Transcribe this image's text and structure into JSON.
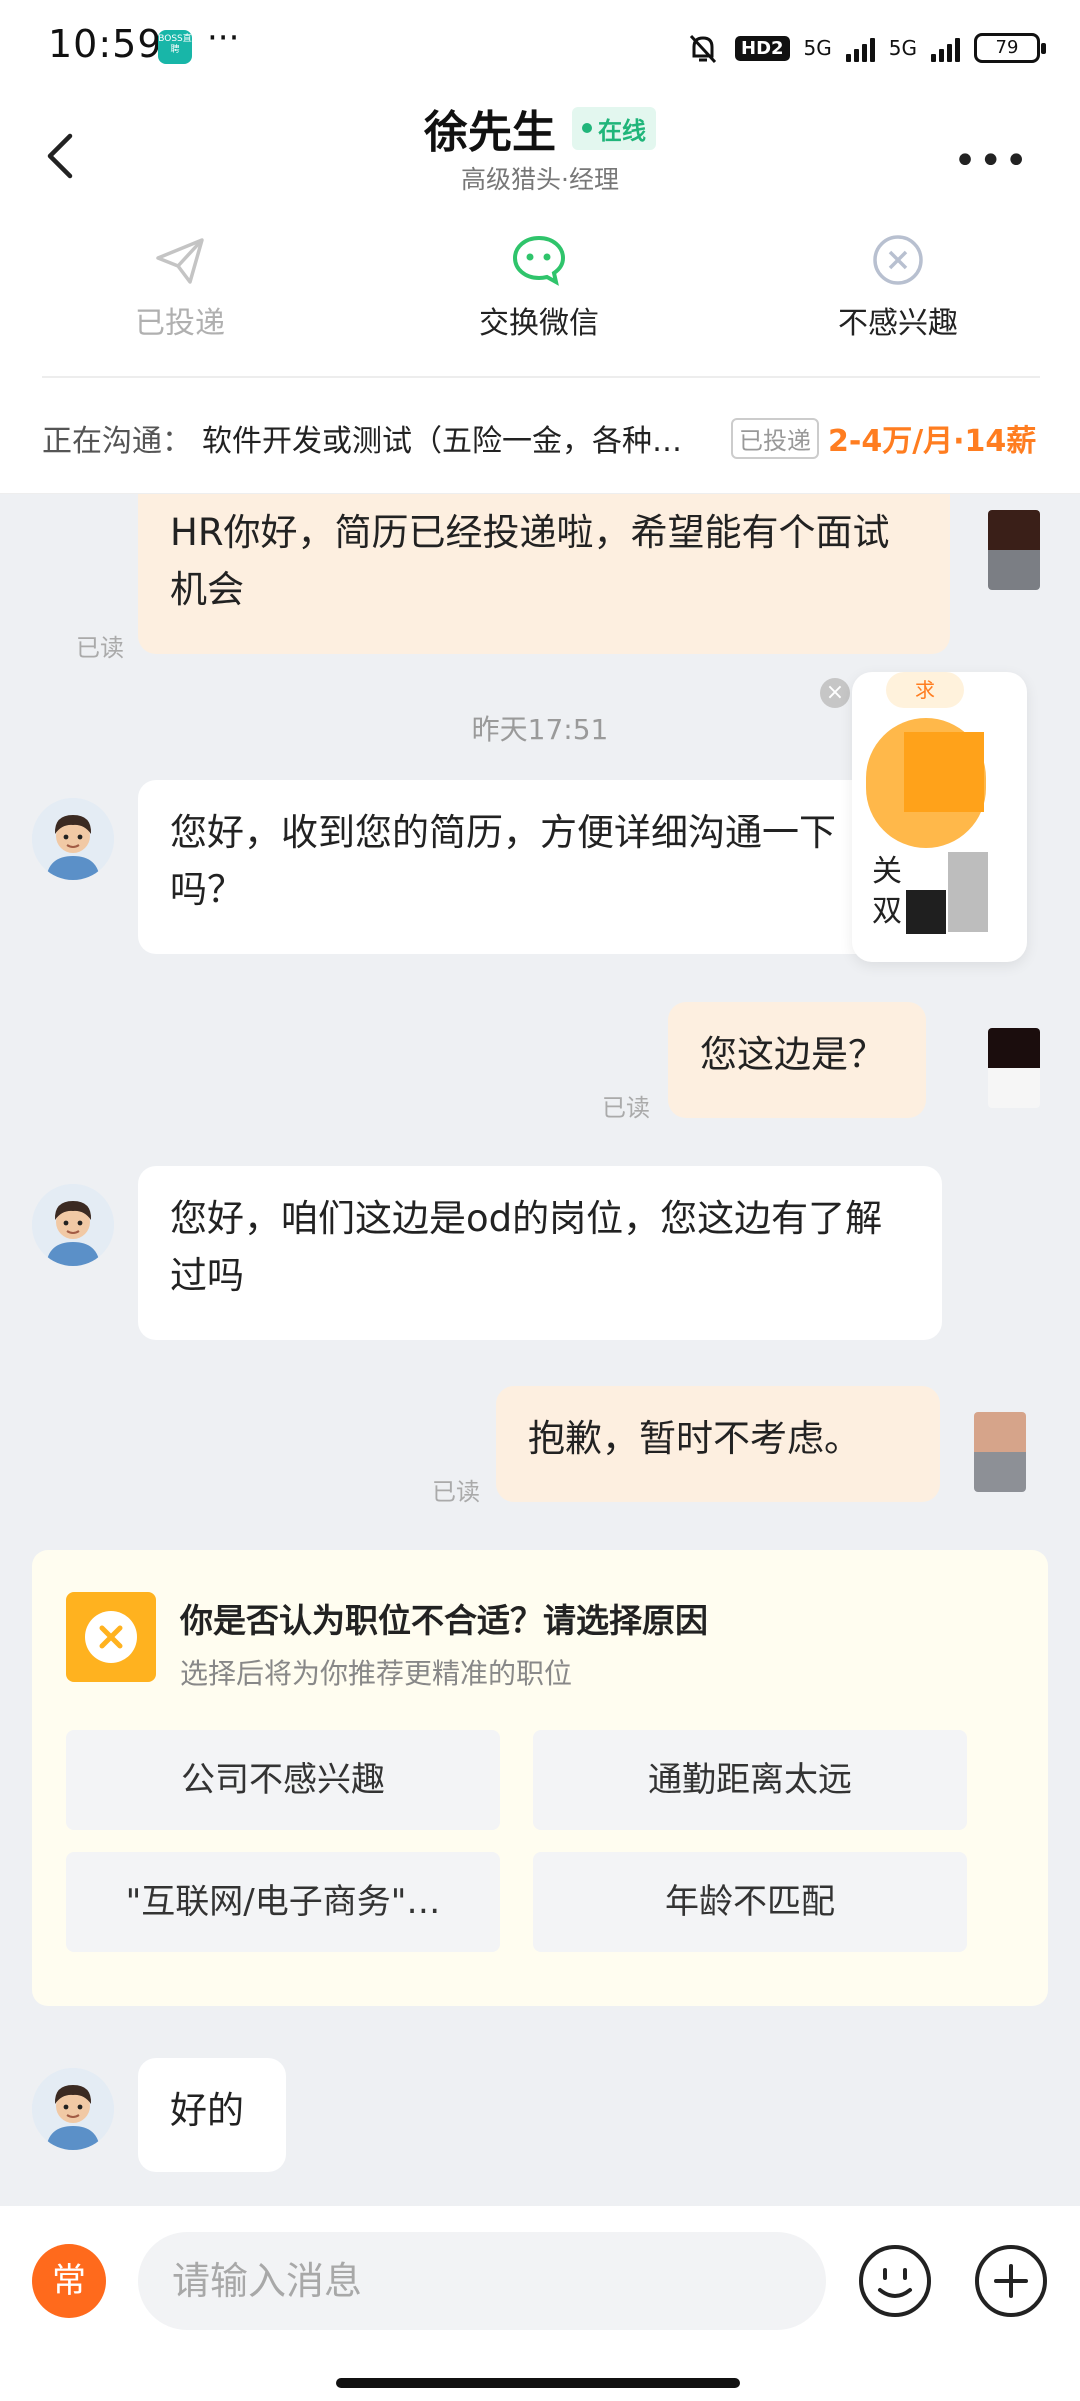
{
  "status_bar": {
    "time": "10:59",
    "app_badge": "BOSS直聘",
    "dots": "···",
    "hd": "HD2",
    "net1": "5G",
    "net2": "5G",
    "battery": "79"
  },
  "header": {
    "name": "徐先生",
    "online": "在线",
    "subtitle": "高级猎头·经理"
  },
  "actions": {
    "applied": "已投递",
    "wechat": "交换微信",
    "not_interested": "不感兴趣"
  },
  "job": {
    "label": "正在沟通：",
    "title": "软件开发或测试（五险一金，各种…",
    "badge": "已投递",
    "salary": "2-4万/月·14薪"
  },
  "messages": {
    "m1": "HR你好，简历已经投递啦，希望能有个面试机会",
    "m1_read": "已读",
    "timestamp": "昨天17:51",
    "m2": "您好，收到您的简历，方便详细沟通一下吗？",
    "m3": "您这边是？",
    "m3_read": "已读",
    "m4": "您好，咱们这边是od的岗位，您这边有了解过吗",
    "m5": "抱歉，暂时不考虑。",
    "m5_read": "已读",
    "m6": "好的"
  },
  "float_card": {
    "tag": "求",
    "line1": "关",
    "line2": "双"
  },
  "feedback": {
    "title": "你是否认为职位不合适？请选择原因",
    "subtitle": "选择后将为你推荐更精准的职位",
    "options": [
      "公司不感兴趣",
      "通勤距离太远",
      "\"互联网/电子商务\"…",
      "年龄不匹配"
    ]
  },
  "input": {
    "common_label": "常",
    "placeholder": "请输入消息"
  },
  "colors": {
    "accent": "#ff7d20",
    "online": "#20b57a",
    "mine_bubble": "#fdefe0",
    "chat_bg": "#eef0f3"
  }
}
